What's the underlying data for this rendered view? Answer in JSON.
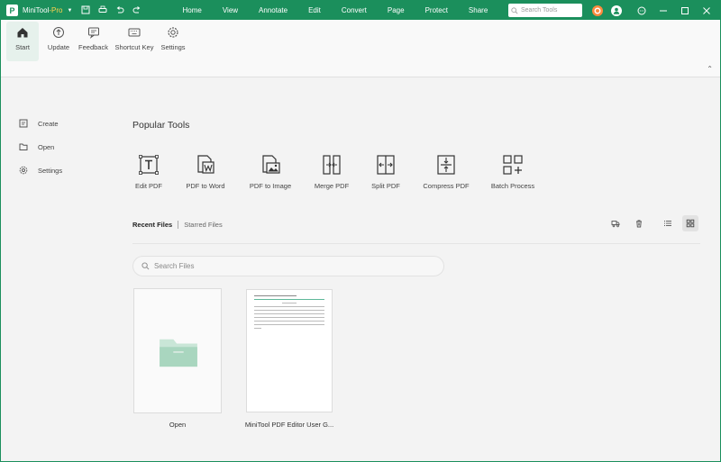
{
  "app": {
    "logo_letter": "P",
    "name": "MiniTool",
    "edition": "-Pro",
    "accent_color": "#1b8f5c"
  },
  "menu": [
    "Home",
    "View",
    "Annotate",
    "Edit",
    "Convert",
    "Page",
    "Protect",
    "Share",
    "Help"
  ],
  "search_tools": {
    "placeholder": "Search Tools"
  },
  "ribbon": {
    "items": [
      {
        "label": "Start",
        "icon": "home-icon",
        "active": true
      },
      {
        "label": "Update",
        "icon": "update-icon"
      },
      {
        "label": "Feedback",
        "icon": "feedback-icon"
      },
      {
        "label": "Shortcut Key",
        "icon": "keyboard-icon"
      },
      {
        "label": "Settings",
        "icon": "gear-icon"
      }
    ]
  },
  "sidebar": {
    "items": [
      {
        "label": "Create",
        "icon": "create-icon"
      },
      {
        "label": "Open",
        "icon": "folder-icon"
      },
      {
        "label": "Settings",
        "icon": "gear-icon"
      }
    ]
  },
  "popular": {
    "title": "Popular Tools",
    "tools": [
      {
        "label": "Edit PDF",
        "icon": "edit-pdf-icon"
      },
      {
        "label": "PDF to Word",
        "icon": "pdf-to-word-icon"
      },
      {
        "label": "PDF to Image",
        "icon": "pdf-to-image-icon"
      },
      {
        "label": "Merge PDF",
        "icon": "merge-pdf-icon"
      },
      {
        "label": "Split PDF",
        "icon": "split-pdf-icon"
      },
      {
        "label": "Compress PDF",
        "icon": "compress-pdf-icon"
      },
      {
        "label": "Batch Process",
        "icon": "batch-process-icon"
      }
    ]
  },
  "files": {
    "tab_recent": "Recent Files",
    "tab_starred": "Starred Files",
    "search_placeholder": "Search Files",
    "cards": [
      {
        "label": "Open"
      },
      {
        "label": "MiniTool PDF Editor User G..."
      }
    ]
  }
}
